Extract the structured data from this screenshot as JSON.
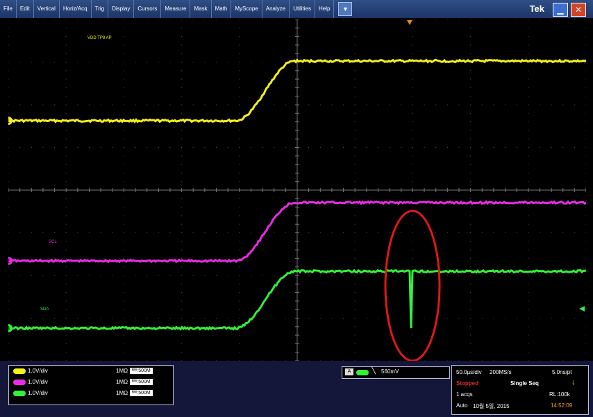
{
  "menu": {
    "items": [
      "File",
      "Edit",
      "Vertical",
      "Horiz/Acq",
      "Trig",
      "Display",
      "Cursors",
      "Measure",
      "Mask",
      "Math",
      "MyScope",
      "Analyze",
      "Utilities",
      "Help"
    ]
  },
  "brand": "Tek",
  "traces": {
    "ch1": {
      "marker": "1",
      "label": "VDD TP8 AP",
      "color": "#f5ef1c"
    },
    "ch2": {
      "marker": "2",
      "label": "SCL",
      "color": "#ea2be6"
    },
    "ch3": {
      "marker": "3",
      "label": "SDA",
      "color": "#35f03a"
    }
  },
  "channels": [
    {
      "badge": "C1",
      "color": "#f5ef1c",
      "scale": "1.0V/div",
      "impedance": "1MΩ",
      "bw": "500M"
    },
    {
      "badge": "C2",
      "color": "#ea2be6",
      "scale": "1.0V/div",
      "impedance": "1MΩ",
      "bw": "500M"
    },
    {
      "badge": "C3",
      "color": "#35f03a",
      "scale": "1.0V/div",
      "impedance": "1MΩ",
      "bw": "500M"
    }
  ],
  "trigger": {
    "source": "C3",
    "level": "560mV"
  },
  "acquisition": {
    "horizontal": "50.0µs/div",
    "sample_rate": "200MS/s",
    "resolution": "5.0ns/pt",
    "state": "Stopped",
    "mode": "Single Seq",
    "acqs": "1 acqs",
    "record_length": "RL:100k",
    "trigger_mode": "Auto",
    "date": "10월 5일, 2015",
    "time": "14:52:09"
  },
  "annotation_color": "#e01818"
}
